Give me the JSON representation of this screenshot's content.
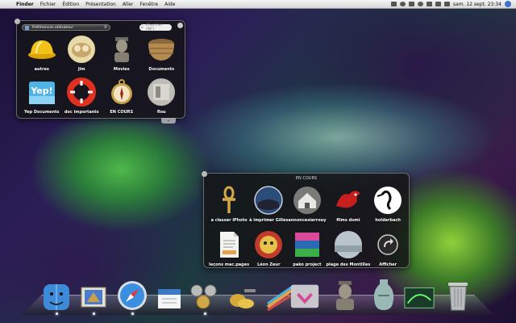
{
  "menubar": {
    "app": "Finder",
    "items": [
      "Fichier",
      "Édition",
      "Présentation",
      "Aller",
      "Fenêtre",
      "Aide"
    ],
    "clock": "sam. 12 sept.  23:34"
  },
  "stack1": {
    "path": "Préférences utilisateur",
    "search_placeholder": "Chercher (⌘F)",
    "items": [
      {
        "label": "autres",
        "icon": "hard-hat-icon"
      },
      {
        "label": "Jim",
        "icon": "portrait-icon"
      },
      {
        "label": "Movies",
        "icon": "bust-icon"
      },
      {
        "label": "Documents",
        "icon": "basket-icon"
      },
      {
        "label": "Yep Documents",
        "icon": "yep-folder-icon"
      },
      {
        "label": "doc importants",
        "icon": "life-ring-icon"
      },
      {
        "label": "EN COURS",
        "icon": "compass-icon"
      },
      {
        "label": "flou",
        "icon": "photo-icon"
      }
    ]
  },
  "stack2": {
    "title": "EN COURS",
    "items": [
      {
        "label": "a classer iPhoto",
        "icon": "ankh-icon"
      },
      {
        "label": "à imprimer Gilles",
        "icon": "globe-icon"
      },
      {
        "label": "annoncesiarrouy",
        "icon": "house-icon"
      },
      {
        "label": "films domi",
        "icon": "dragon-icon"
      },
      {
        "label": "holderbach",
        "icon": "stork-icon"
      },
      {
        "label": "leçons mac.pages",
        "icon": "pages-doc-icon"
      },
      {
        "label": "Léon Zeur",
        "icon": "mask-icon"
      },
      {
        "label": "pako project",
        "icon": "poster-icon"
      },
      {
        "label": "plage des Montilles",
        "icon": "beach-icon"
      },
      {
        "label": "Afficher",
        "icon": "arrow-circle-icon"
      }
    ]
  },
  "dock": [
    {
      "name": "finder-icon"
    },
    {
      "name": "mail-icon"
    },
    {
      "name": "safari-icon"
    },
    {
      "name": "calendar-icon"
    },
    {
      "name": "system-prefs-icon"
    },
    {
      "name": "coins-icon"
    },
    {
      "name": "pages-icon"
    },
    {
      "name": "stack-folder-icon"
    },
    {
      "name": "bust-icon"
    },
    {
      "name": "vase-icon"
    },
    {
      "name": "stack-pile-icon"
    },
    {
      "name": "trash-icon"
    }
  ],
  "colors": {
    "menubar": "#e6e6e6",
    "panel_bg": "#141416",
    "panel_text": "#ffffff"
  }
}
